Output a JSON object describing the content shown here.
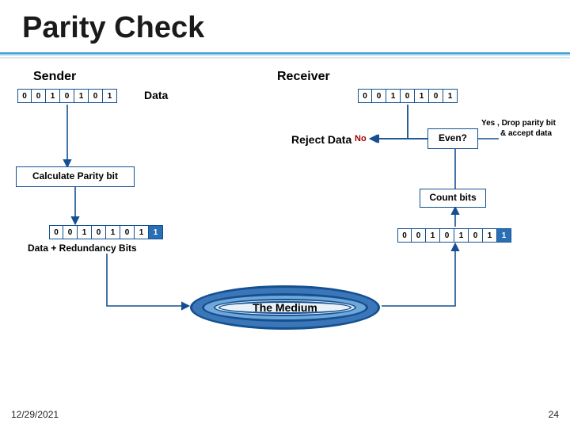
{
  "title": "Parity Check",
  "sender_label": "Sender",
  "receiver_label": "Receiver",
  "data_label": "Data",
  "reject_label": "Reject Data",
  "no_label": "No",
  "even_label": "Even?",
  "yes_line1": "Yes , Drop parity bit",
  "yes_line2": "& accept data",
  "calc_label": "Calculate Parity bit",
  "count_label": "Count bits",
  "redundancy_label": "Data + Redundancy Bits",
  "medium_label": "The Medium",
  "footer_date": "12/29/2021",
  "footer_page": "24",
  "chart_data": {
    "type": "diagram",
    "sender_bits": [
      "0",
      "0",
      "1",
      "0",
      "1",
      "0",
      "1"
    ],
    "receiver_bits": [
      "0",
      "0",
      "1",
      "0",
      "1",
      "0",
      "1"
    ],
    "sender_redundant": [
      "0",
      "0",
      "1",
      "0",
      "1",
      "0",
      "1",
      "1"
    ],
    "receiver_redundant": [
      "0",
      "0",
      "1",
      "0",
      "1",
      "0",
      "1",
      "1"
    ],
    "decision_node": "Even?",
    "edges_from_decision": {
      "No": "Reject Data",
      "Yes": "Drop parity bit & accept data"
    },
    "flow": [
      "Sender Data",
      "Calculate Parity bit",
      "Data + Redundancy Bits",
      "The Medium",
      "Receiver Redundant Bits",
      "Count bits",
      "Receiver Data",
      "Even?"
    ]
  }
}
